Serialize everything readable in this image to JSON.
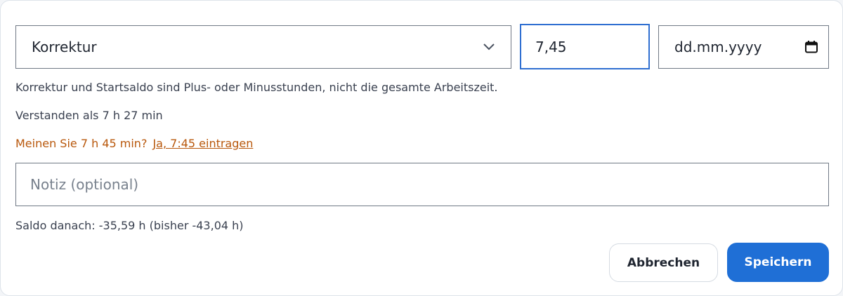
{
  "form": {
    "type_select": {
      "value": "Korrektur",
      "icon": "chevron-down-icon"
    },
    "amount_input": {
      "value": "7,45"
    },
    "date_input": {
      "placeholder": "dd.mm.yyyy",
      "icon": "calendar-icon"
    },
    "hint_text": "Korrektur und Startsaldo sind Plus- oder Minusstunden, nicht die gesamte Arbeitszeit.",
    "understood_text": "Verstanden als 7 h 27 min",
    "suggestion": {
      "question": "Meinen Sie 7 h 45 min?",
      "action_label": "Ja, 7:45 eintragen"
    },
    "note_input": {
      "placeholder": "Notiz (optional)"
    },
    "balance_text": "Saldo danach: -35,59 h (bisher -43,04 h)"
  },
  "actions": {
    "cancel_label": "Abbrechen",
    "save_label": "Speichern"
  },
  "colors": {
    "accent": "#1f6fd6",
    "focus_border": "#2f6fd1",
    "warning": "#b8570b"
  }
}
